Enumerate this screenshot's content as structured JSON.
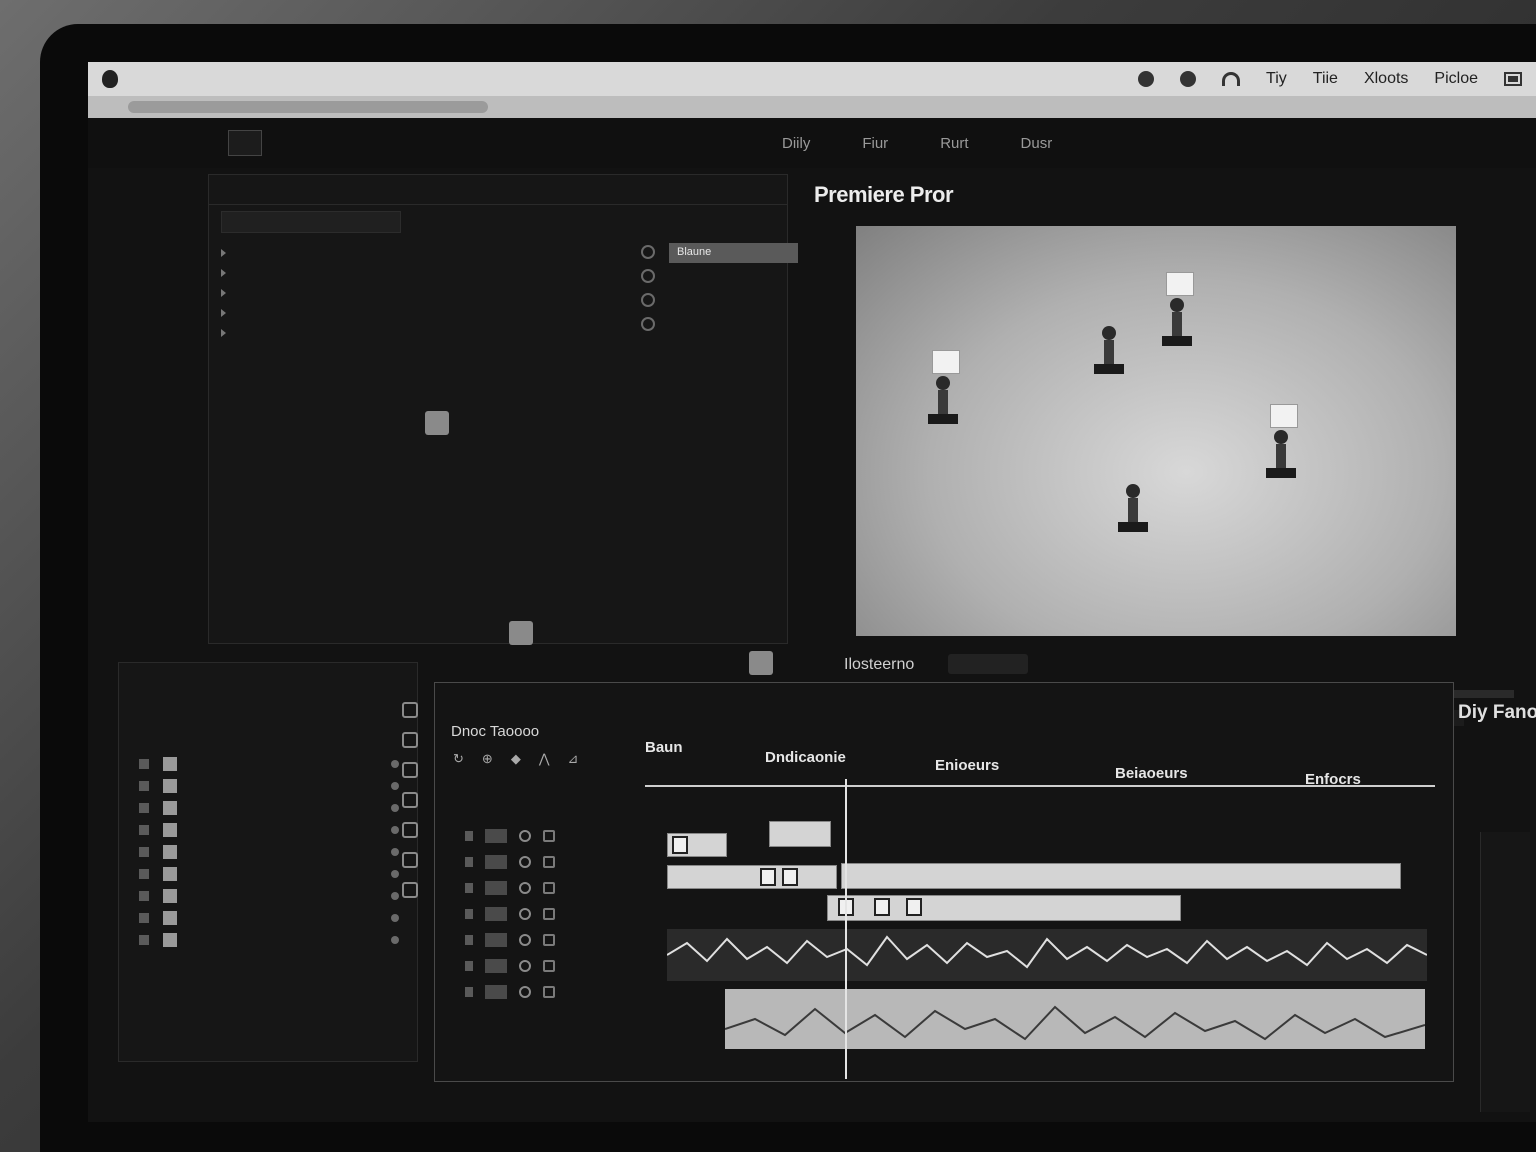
{
  "menubar": {
    "app_name": "",
    "menus": [
      "",
      "",
      "",
      "",
      "",
      "",
      ""
    ],
    "status_items": [
      "Tiy",
      "Tiie",
      "Xloots",
      "Picloe"
    ]
  },
  "workspace": {
    "tabs": [
      "",
      "",
      "",
      "",
      "",
      "Diily",
      "Fiur",
      "Rurt",
      "Dusr"
    ]
  },
  "project_panel": {
    "source_label": "Blaune"
  },
  "program_monitor": {
    "title": "Premiere Pror",
    "timecode": "Ilosteerno",
    "duration_label": "Diy Fanoed"
  },
  "timeline": {
    "sequence_timecode": "Dnoc Taoooo",
    "ruler_labels": [
      "Baun",
      "Dndicaonie",
      "Enioeurs",
      "Beiaoeurs",
      "Enfocrs"
    ]
  },
  "colors": {
    "panel_bg": "#161616",
    "viewer_bg": "#c8c8c8",
    "accent_light": "#d4d4d4"
  }
}
